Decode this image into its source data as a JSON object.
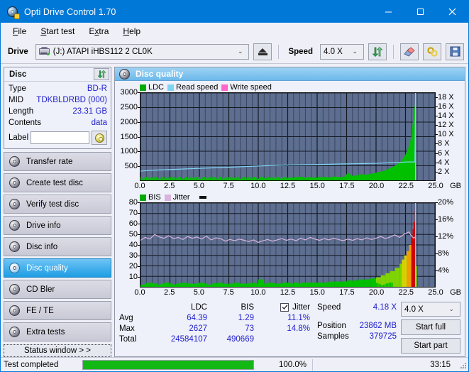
{
  "window": {
    "title": "Opti Drive Control 1.70",
    "app_icon": "disc-icon",
    "minimize": "minimize-icon",
    "maximize": "maximize-icon",
    "close": "close-icon"
  },
  "menu": [
    {
      "label": "File",
      "accel": "F"
    },
    {
      "label": "Start test",
      "accel": "S"
    },
    {
      "label": "Extra",
      "accel": "x"
    },
    {
      "label": "Help",
      "accel": "H"
    }
  ],
  "toolbar": {
    "drive_label": "Drive",
    "drive_value": "(J:)  ATAPI iHBS112  2 CL0K",
    "eject": "eject-icon",
    "speed_label": "Speed",
    "speed_value": "4.0 X",
    "refresh": "refresh-icon",
    "eraser": "eraser-icon",
    "link": "link-icon",
    "save": "save-icon"
  },
  "disc_panel": {
    "title": "Disc",
    "refresh": "refresh-icon",
    "rows": [
      {
        "key": "Type",
        "value": "BD-R"
      },
      {
        "key": "MID",
        "value": "TDKBLDRBD (000)"
      },
      {
        "key": "Length",
        "value": "23.31 GB"
      },
      {
        "key": "Contents",
        "value": "data"
      }
    ],
    "label_key": "Label",
    "label_value": "",
    "label_placeholder": ""
  },
  "nav": {
    "items": [
      {
        "label": "Transfer rate",
        "active": false
      },
      {
        "label": "Create test disc",
        "active": false
      },
      {
        "label": "Verify test disc",
        "active": false
      },
      {
        "label": "Drive info",
        "active": false
      },
      {
        "label": "Disc info",
        "active": false
      },
      {
        "label": "Disc quality",
        "active": true
      },
      {
        "label": "CD Bler",
        "active": false
      },
      {
        "label": "FE / TE",
        "active": false
      },
      {
        "label": "Extra tests",
        "active": false
      }
    ],
    "status_window": "Status window > >"
  },
  "main": {
    "title": "Disc quality",
    "title_icon": "disc-quality-icon"
  },
  "stats": {
    "col_ldc": "LDC",
    "col_bis": "BIS",
    "col_jitter": "Jitter",
    "jitter_checked": true,
    "rows": [
      {
        "label": "Avg",
        "ldc": "64.39",
        "bis": "1.29",
        "jitter": "11.1%"
      },
      {
        "label": "Max",
        "ldc": "2627",
        "bis": "73",
        "jitter": "14.8%"
      },
      {
        "label": "Total",
        "ldc": "24584107",
        "bis": "490669",
        "jitter": ""
      }
    ],
    "speed_key": "Speed",
    "speed_value": "4.18 X",
    "position_key": "Position",
    "position_value": "23862 MB",
    "samples_key": "Samples",
    "samples_value": "379725",
    "speed_select": "4.0 X",
    "start_full": "Start full",
    "start_part": "Start part"
  },
  "statusbar": {
    "text": "Test completed",
    "percent_label": "100.0%",
    "percent": 100,
    "time": "33:15"
  },
  "colors": {
    "accent": "#0078d7",
    "plot_bg": "#5d6e90",
    "ldc": "#00c000",
    "read_speed": "#7fd4f5",
    "write_speed": "#ff66cc",
    "bis": "#00c000",
    "jitter": "#d8b4dc",
    "value_text": "#2222cc",
    "progress": "#14b814"
  },
  "chart_data": [
    {
      "type": "area",
      "name": "disc-quality-ldc",
      "title": "",
      "xlabel": "GB",
      "ylabel": "LDC",
      "xlim": [
        0,
        25
      ],
      "ylim": [
        0,
        3000
      ],
      "xticks": [
        "0.0",
        "2.5",
        "5.0",
        "7.5",
        "10.0",
        "12.5",
        "15.0",
        "17.5",
        "20.0",
        "22.5",
        "25.0"
      ],
      "yticks": [
        500,
        1000,
        1500,
        2000,
        2500,
        3000
      ],
      "y2label": "Speed",
      "y2lim": [
        0,
        19
      ],
      "y2ticks": [
        "2 X",
        "4 X",
        "6 X",
        "8 X",
        "10 X",
        "12 X",
        "14 X",
        "16 X",
        "18 X"
      ],
      "grid": true,
      "legend_position": "top-left",
      "legend": [
        "LDC",
        "Read speed",
        "Write speed"
      ],
      "series": [
        {
          "name": "LDC",
          "color": "#00c000",
          "x": [
            0.0,
            0.5,
            1.0,
            1.5,
            2.0,
            2.5,
            3.0,
            3.5,
            4.0,
            4.5,
            5.0,
            5.5,
            6.0,
            6.5,
            7.0,
            7.5,
            8.0,
            8.5,
            9.0,
            9.5,
            10.0,
            10.3,
            10.6,
            11.0,
            11.5,
            12.0,
            12.5,
            13.0,
            13.5,
            14.0,
            14.5,
            15.0,
            15.5,
            16.0,
            16.5,
            17.0,
            17.3,
            17.6,
            18.0,
            18.4,
            18.8,
            19.2,
            19.6,
            20.0,
            20.4,
            20.8,
            21.2,
            21.6,
            22.0,
            22.2,
            22.4,
            22.6,
            22.8,
            23.0,
            23.1,
            23.2,
            23.3,
            23.35,
            23.4
          ],
          "values": [
            30,
            25,
            28,
            26,
            30,
            28,
            26,
            30,
            28,
            32,
            30,
            28,
            34,
            30,
            32,
            30,
            35,
            32,
            38,
            36,
            40,
            95,
            42,
            50,
            48,
            60,
            55,
            70,
            120,
            75,
            90,
            85,
            110,
            95,
            130,
            105,
            115,
            260,
            150,
            175,
            210,
            195,
            230,
            260,
            300,
            340,
            420,
            500,
            610,
            700,
            820,
            960,
            1180,
            1500,
            1900,
            2300,
            2627,
            2100,
            0
          ]
        },
        {
          "name": "Read speed",
          "color": "#7fd4f5",
          "x": [
            0.0,
            1.0,
            2.0,
            3.0,
            4.0,
            5.0,
            6.0,
            7.0,
            8.0,
            9.0,
            10.0,
            11.0,
            12.0,
            13.0,
            14.0,
            15.0,
            16.0,
            17.0,
            18.0,
            19.0,
            20.0,
            21.0,
            22.0,
            22.6,
            23.0,
            23.3,
            23.35
          ],
          "values": [
            2.0,
            2.2,
            2.3,
            2.4,
            2.5,
            2.6,
            2.7,
            2.8,
            2.9,
            3.0,
            3.1,
            3.2,
            3.3,
            3.35,
            3.4,
            3.45,
            3.5,
            3.55,
            3.6,
            3.65,
            3.7,
            3.8,
            3.9,
            4.0,
            4.0,
            4.0,
            18.5
          ]
        },
        {
          "name": "Write speed",
          "color": "#ff66cc",
          "x": [],
          "values": []
        }
      ]
    },
    {
      "type": "area",
      "name": "disc-quality-bis-jitter",
      "title": "",
      "xlabel": "GB",
      "ylabel": "BIS",
      "xlim": [
        0,
        25
      ],
      "ylim": [
        0,
        80
      ],
      "xticks": [
        "0.0",
        "2.5",
        "5.0",
        "7.5",
        "10.0",
        "12.5",
        "15.0",
        "17.5",
        "20.0",
        "22.5",
        "25.0"
      ],
      "yticks": [
        10,
        20,
        30,
        40,
        50,
        60,
        70,
        80
      ],
      "y2label": "Jitter",
      "y2lim": [
        0,
        20
      ],
      "y2ticks": [
        "4%",
        "8%",
        "12%",
        "16%",
        "20%"
      ],
      "grid": true,
      "legend_position": "top-left",
      "legend": [
        "BIS",
        "Jitter"
      ],
      "series": [
        {
          "name": "BIS",
          "color": "gradient-green-yellow-red",
          "x": [
            0.0,
            0.5,
            1.0,
            1.5,
            2.0,
            2.5,
            3.0,
            3.5,
            4.0,
            4.5,
            5.0,
            5.5,
            6.0,
            6.5,
            7.0,
            7.5,
            8.0,
            8.5,
            9.0,
            9.5,
            10.0,
            10.5,
            11.0,
            11.5,
            12.0,
            12.5,
            13.0,
            13.5,
            14.0,
            14.5,
            15.0,
            15.5,
            16.0,
            16.5,
            17.0,
            17.5,
            18.0,
            18.5,
            19.0,
            19.5,
            20.0,
            20.4,
            20.8,
            21.2,
            21.6,
            22.0,
            22.2,
            22.4,
            22.6,
            22.8,
            23.0,
            23.1,
            23.2,
            23.3,
            23.35
          ],
          "values": [
            2,
            2,
            3,
            2,
            3,
            2,
            3,
            2,
            3,
            3,
            3,
            2,
            3,
            3,
            3,
            2,
            3,
            3,
            3,
            3,
            7,
            3,
            3,
            3,
            4,
            3,
            4,
            3,
            4,
            4,
            4,
            4,
            5,
            5,
            5,
            6,
            6,
            7,
            7,
            8,
            9,
            11,
            13,
            15,
            18,
            22,
            26,
            30,
            34,
            40,
            48,
            55,
            62,
            73,
            20
          ]
        },
        {
          "name": "Jitter",
          "color": "#d8b4dc",
          "x": [
            0.0,
            0.4,
            0.8,
            1.2,
            1.6,
            2.0,
            2.4,
            2.8,
            3.2,
            3.6,
            4.0,
            4.4,
            4.8,
            5.2,
            5.6,
            6.0,
            6.4,
            6.8,
            7.2,
            7.6,
            8.0,
            8.4,
            8.8,
            9.2,
            9.6,
            10.0,
            10.4,
            10.8,
            11.2,
            11.6,
            12.0,
            12.4,
            12.8,
            13.2,
            13.6,
            14.0,
            14.4,
            14.8,
            15.2,
            15.6,
            16.0,
            16.4,
            16.8,
            17.2,
            17.6,
            18.0,
            18.4,
            18.8,
            19.2,
            19.6,
            20.0,
            20.4,
            20.8,
            21.2,
            21.6,
            22.0,
            22.4,
            22.8,
            23.0,
            23.2,
            23.3
          ],
          "values": [
            11.1,
            11.8,
            11.4,
            12.5,
            11.9,
            11.6,
            12.2,
            11.5,
            11.8,
            11.3,
            12.0,
            11.6,
            11.9,
            11.4,
            12.1,
            11.2,
            11.7,
            11.5,
            10.9,
            11.3,
            11.0,
            11.4,
            11.1,
            10.8,
            11.2,
            10.6,
            11.0,
            11.3,
            10.9,
            11.2,
            11.5,
            11.1,
            11.4,
            11.0,
            11.6,
            11.2,
            11.8,
            11.4,
            11.1,
            11.5,
            11.2,
            11.6,
            11.3,
            11.0,
            11.4,
            11.1,
            11.5,
            11.2,
            11.7,
            11.3,
            11.6,
            12.0,
            11.5,
            11.9,
            12.4,
            11.8,
            12.6,
            13.1,
            12.2,
            11.6,
            11.9
          ]
        }
      ]
    }
  ]
}
